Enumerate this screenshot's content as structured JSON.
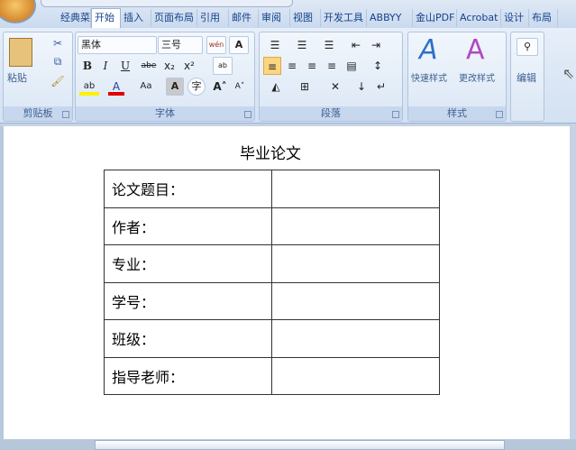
{
  "tabs": [
    "经典菜单",
    "开始",
    "插入",
    "页面布局",
    "引用",
    "邮件",
    "审阅",
    "视图",
    "开发工具",
    "ABBYY",
    "金山PDF",
    "Acrobat",
    "设计",
    "布局"
  ],
  "active_tab": "开始",
  "clipboard": {
    "label": "剪贴板",
    "paste": "粘贴"
  },
  "font": {
    "label": "字体",
    "name": "黑体",
    "size": "三号",
    "bold": "B",
    "italic": "I",
    "underline": "U",
    "strike": "abe",
    "sub": "x₂",
    "sup": "x²",
    "case": "Aa",
    "char_shading": "A",
    "grow": "A˄",
    "shrink": "A˅",
    "phonetic": "wén",
    "char_border": "A",
    "enclose": "字"
  },
  "paragraph": {
    "label": "段落"
  },
  "styles": {
    "label": "样式",
    "quick": "快速样式",
    "change": "更改样式"
  },
  "editing": {
    "label": "编辑"
  },
  "document": {
    "title": "毕业论文",
    "rows": [
      [
        "论文题目：",
        ""
      ],
      [
        "作者：",
        ""
      ],
      [
        "专业：",
        ""
      ],
      [
        "学号：",
        ""
      ],
      [
        "班级：",
        ""
      ],
      [
        "指导老师：",
        ""
      ]
    ]
  }
}
